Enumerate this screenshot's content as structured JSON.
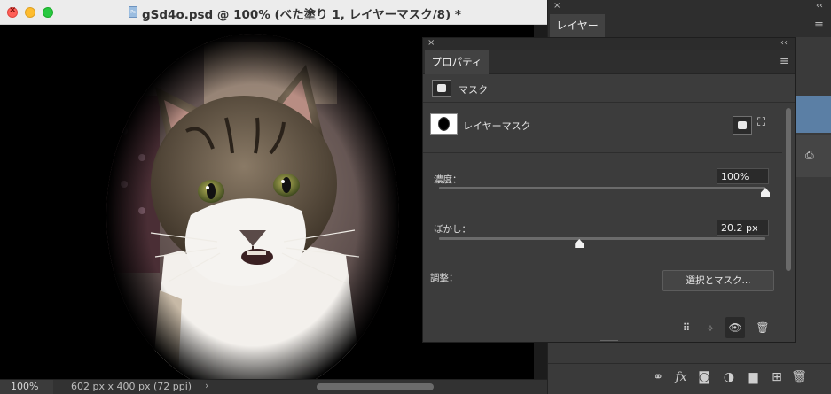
{
  "document": {
    "title": "gSd4o.psd @ 100% (べた塗り 1, レイヤーマスク/8) *",
    "file_badge": "Ps",
    "zoom": "100%",
    "doc_size": "602 px x 400 px (72 ppi)",
    "status_arrow": "›"
  },
  "layers_panel": {
    "tab": "レイヤー",
    "menu_icon": "≡",
    "close_glyph": "×",
    "collapse_glyph": "‹‹",
    "footer_icons": {
      "link": "⚭",
      "fx": "fx",
      "mask": "◙",
      "adjustment": "◑",
      "folder": "▆",
      "new": "⊞",
      "trash": "🗑"
    },
    "row_icon": "⎙"
  },
  "properties": {
    "tab": "プロパティ",
    "menu_icon": "≡",
    "close_glyph": "×",
    "collapse_glyph": "‹‹",
    "mask_section": "マスク",
    "layer_mask_label": "レイヤーマスク",
    "vector_mask_glyph": "⛶",
    "density": {
      "label": "濃度：",
      "value": "100%",
      "level": 1.0
    },
    "feather": {
      "label": "ぼかし：",
      "value": "20.2 px",
      "level": 0.43
    },
    "refine_label": "調整：",
    "select_mask_button": "選択とマスク...",
    "footer_icons": {
      "select": "⠿",
      "apply": "⟡",
      "eye": "👁",
      "trash": "🗑"
    }
  }
}
